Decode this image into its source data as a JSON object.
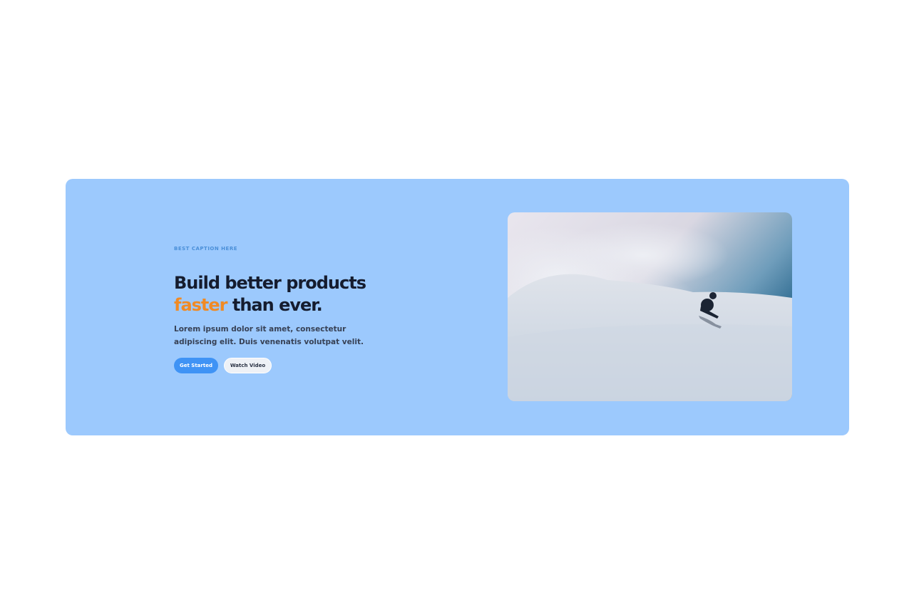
{
  "hero": {
    "caption": "BEST CAPTION HERE",
    "headline_line1": "Build better products",
    "headline_accent": "faster",
    "headline_rest": " than ever.",
    "description": "Lorem ipsum dolor sit amet, consectetur adipiscing elit. Duis venenatis volutpat velit.",
    "primary_button": "Get Started",
    "secondary_button": "Watch Video",
    "image_subject": "skier in powder snow",
    "colors": {
      "panel_background": "#9cc9fd",
      "accent": "#f08a24",
      "primary_button": "#3f93f5",
      "heading": "#151c2e"
    }
  }
}
